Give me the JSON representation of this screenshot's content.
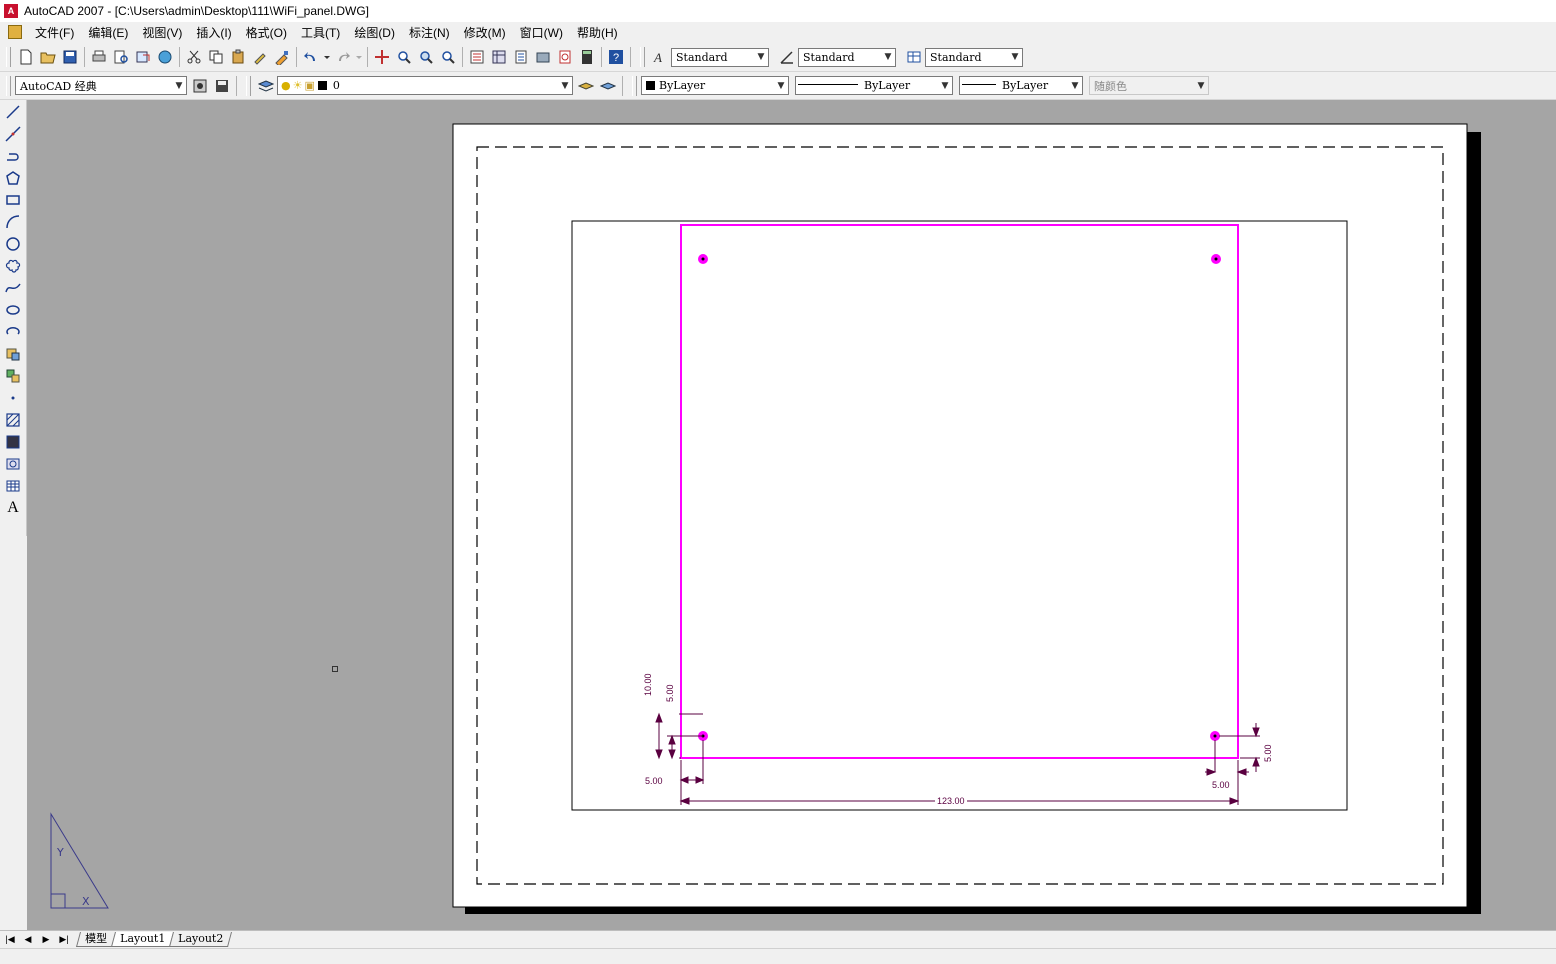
{
  "window": {
    "title": "AutoCAD 2007 - [C:\\Users\\admin\\Desktop\\111\\WiFi_panel.DWG]"
  },
  "menu": [
    "文件(F)",
    "编辑(E)",
    "视图(V)",
    "插入(I)",
    "格式(O)",
    "工具(T)",
    "绘图(D)",
    "标注(N)",
    "修改(M)",
    "窗口(W)",
    "帮助(H)"
  ],
  "styles": {
    "text_style": "Standard",
    "dim_style": "Standard",
    "table_style": "Standard"
  },
  "workspace": "AutoCAD 经典",
  "layer": {
    "current": "0"
  },
  "properties": {
    "color": "ByLayer",
    "linetype": "ByLayer",
    "lineweight": "ByLayer",
    "plot_style": "随颜色"
  },
  "tabs": [
    "模型",
    "Layout1",
    "Layout2"
  ],
  "active_tab": "Layout1",
  "drawing": {
    "dimensions": {
      "overall_width": "123.00",
      "left_height": "10.00",
      "left_hole_offset_v": "5.00",
      "left_hole_offset_h": "5.00",
      "right_hole_offset_v": "5.00",
      "right_hole_offset_h": "5.00"
    }
  },
  "colors": {
    "canvas": "#a5a5a5",
    "paper": "#ffffff",
    "outline": "#ff00ff",
    "dimension": "#5a0040"
  }
}
